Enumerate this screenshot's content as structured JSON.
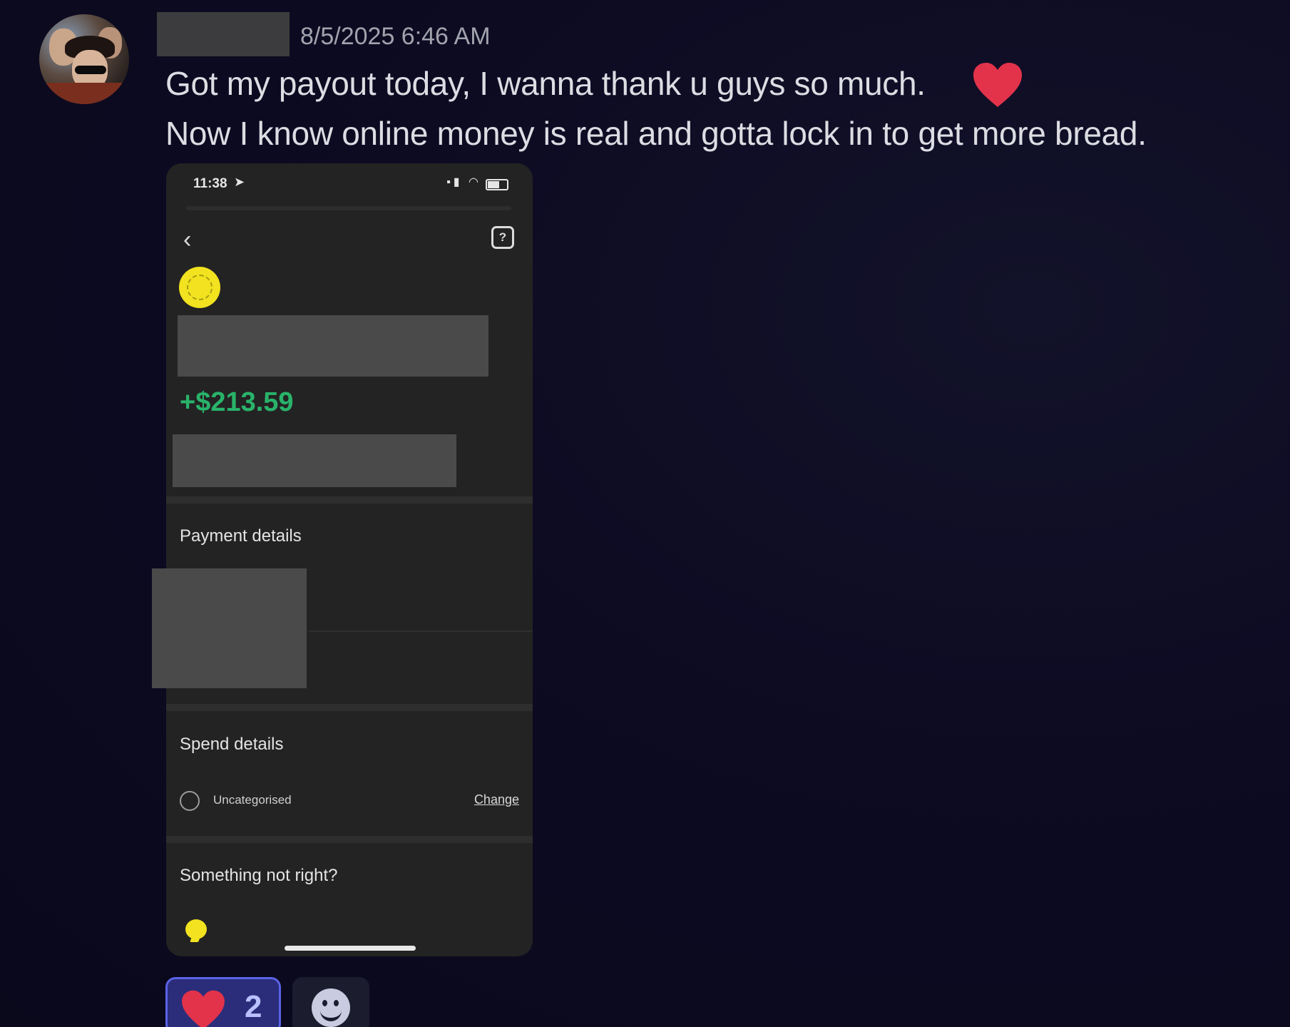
{
  "message": {
    "timestamp": "8/5/2025 6:46 AM",
    "line1": "Got my payout today, I wanna thank u guys so much.",
    "line2": "Now I know online money is real and gotta lock in to get more bread.",
    "emoji": "red-heart"
  },
  "attachment": {
    "status_time": "11:38",
    "amount": "+$213.59",
    "amount_color": "#29b36a",
    "section_payment": "Payment details",
    "section_spend": "Spend details",
    "category_label": "Uncategorised",
    "change_label": "Change",
    "section_help": "Something not right?"
  },
  "reactions": [
    {
      "emoji": "red-heart",
      "count": "2"
    }
  ],
  "colors": {
    "background": "#0c0a1e",
    "reaction_bg": "#2b2d7a",
    "reaction_border": "#5b63e8",
    "heart": "#e2334a",
    "coin": "#f2e21f"
  }
}
